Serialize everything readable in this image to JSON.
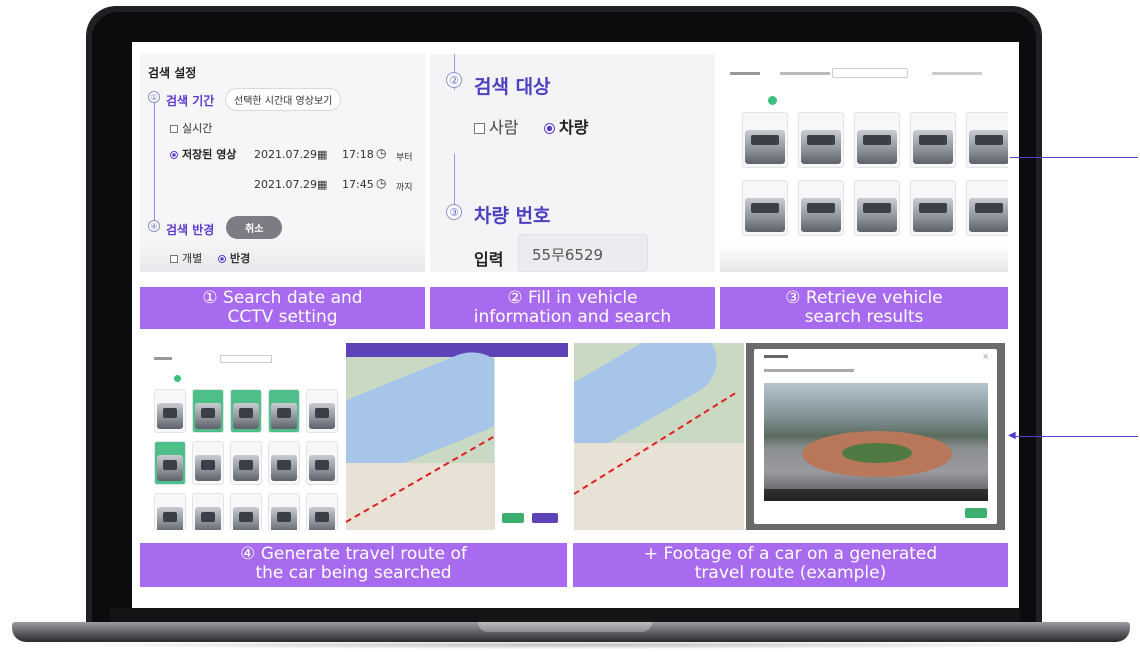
{
  "panels": {
    "search_settings": {
      "title": "검색 설정",
      "period_label": "검색 기간",
      "period_button": "선택한 시간대 영상보기",
      "realtime_option": "실시간",
      "saved_option": "저장된 영상",
      "start_date": "2021.07.29",
      "start_time": "17:18",
      "start_suffix": "부터",
      "end_date": "2021.07.29",
      "end_time": "17:45",
      "end_suffix": "까지",
      "radius_label": "검색 반경",
      "cancel_button": "취소",
      "individual_option": "개별",
      "radius_option": "반경",
      "step1": "①",
      "step4": "④"
    },
    "search_target": {
      "step2": "②",
      "title": "검색 대상",
      "person_option": "사람",
      "vehicle_option": "차량",
      "step3": "③",
      "plate_title": "차량 번호",
      "input_label": "입력",
      "plate_value": "55무6529"
    }
  },
  "captions": {
    "c1_line1": "① Search date and",
    "c1_line2": "CCTV setting",
    "c2_line1": "② Fill in vehicle",
    "c2_line2": "information and search",
    "c3_line1": "③ Retrieve vehicle",
    "c3_line2": "search results",
    "c4_line1": "④ Generate travel route of",
    "c4_line2": "the car being searched",
    "c5_line1": "+ Footage of a car on a generated",
    "c5_line2": "travel route (example)"
  },
  "colors": {
    "caption_bg": "#a86bef",
    "accent": "#5a3bd0"
  }
}
